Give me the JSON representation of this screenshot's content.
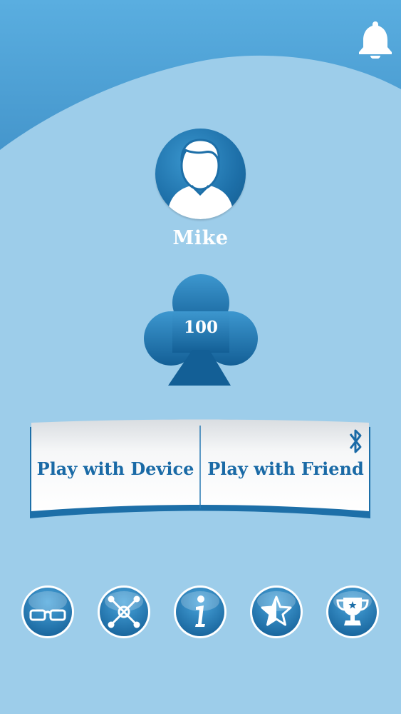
{
  "profile": {
    "name": "Mike"
  },
  "coins": {
    "value": "100"
  },
  "modes": {
    "device_label": "Play with Device",
    "friend_label": "Play with Friend"
  },
  "icons": {
    "notification": "bell-icon",
    "friend_connection": "bluetooth-icon",
    "avatar": "user-silhouette-icon",
    "coins": "club-suit-icon",
    "bottom": [
      "glasses-icon",
      "network-icon",
      "info-icon",
      "star-icon",
      "trophy-icon"
    ]
  },
  "colors": {
    "background": "#9dcdea",
    "top_band": "#4fa3d6",
    "primary": "#1a6aa6",
    "button_face": "#ffffff"
  }
}
